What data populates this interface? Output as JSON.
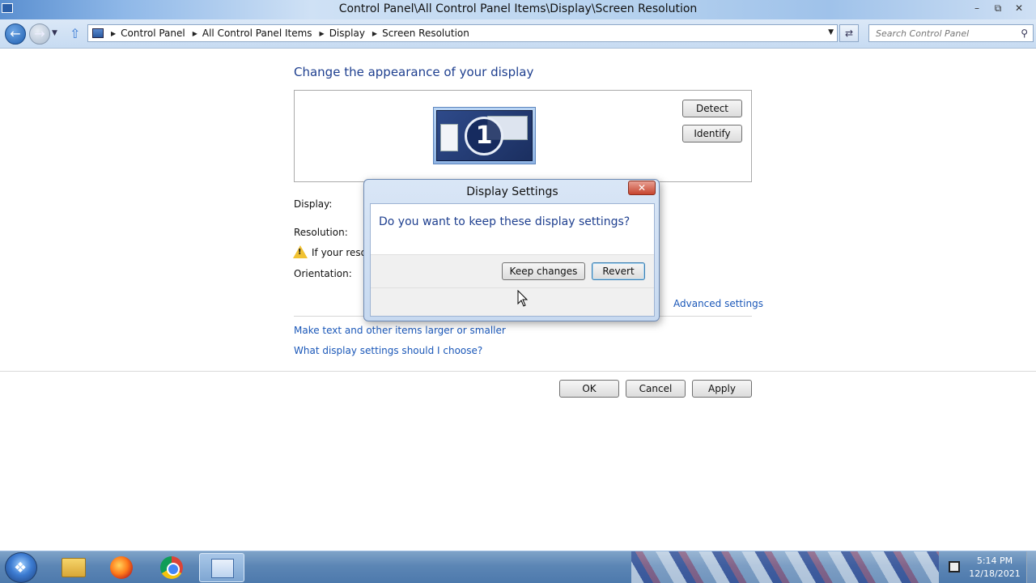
{
  "window": {
    "title": "Control Panel\\All Control Panel Items\\Display\\Screen Resolution",
    "min_glyph": "–",
    "restore_glyph": "⧉",
    "close_glyph": "✕"
  },
  "address": {
    "breadcrumbs": [
      "Control Panel",
      "All Control Panel Items",
      "Display",
      "Screen Resolution"
    ],
    "search_placeholder": "Search Control Panel"
  },
  "main": {
    "heading": "Change the appearance of your display",
    "monitor_number": "1",
    "detect_label": "Detect",
    "identify_label": "Identify",
    "display_label": "Display:",
    "resolution_label": "Resolution:",
    "warning_text": "If your resolu",
    "orientation_label": "Orientation:",
    "advanced_link": "Advanced settings",
    "text_size_link": "Make text and other items larger or smaller",
    "what_display_link": "What display settings should I choose?",
    "ok_label": "OK",
    "cancel_label": "Cancel",
    "apply_label": "Apply"
  },
  "dialog": {
    "title": "Display Settings",
    "question": "Do you want to keep these display settings?",
    "keep_label": "Keep changes",
    "revert_label": "Revert",
    "close_glyph": "✕"
  },
  "taskbar": {
    "items": [
      "windows-explorer",
      "firefox",
      "chrome",
      "control-panel"
    ],
    "clock_time": "5:14 PM",
    "clock_date": "12/18/2021"
  },
  "colors": {
    "link": "#1a57b8",
    "heading": "#1e3f8f",
    "dialog_close": "#c7452f"
  }
}
